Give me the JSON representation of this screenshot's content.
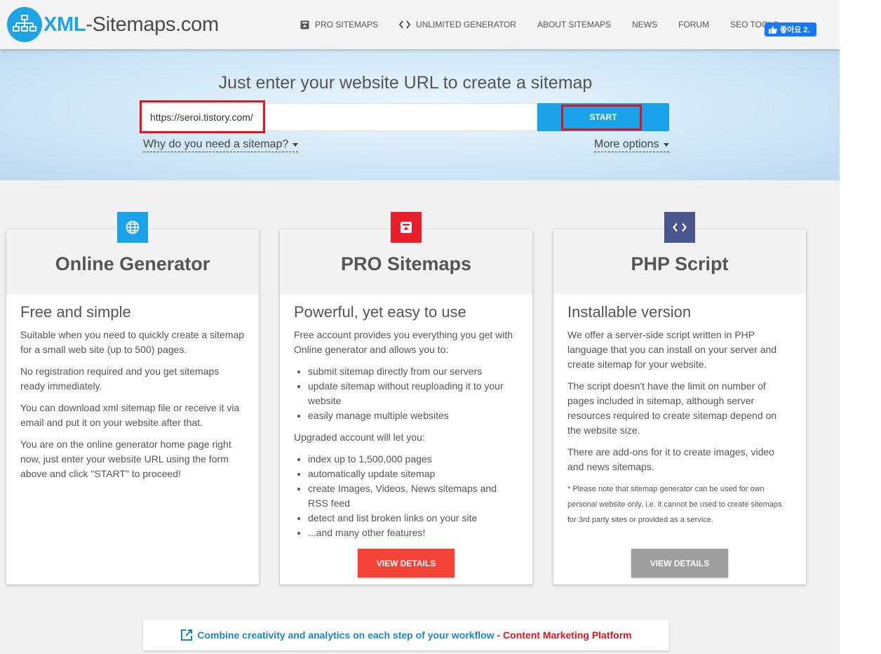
{
  "header": {
    "logo": {
      "accent": "XML",
      "rest": "-Sitemaps.com"
    },
    "nav": [
      {
        "label": "PRO SITEMAPS",
        "icon": "pro-sitemaps-icon"
      },
      {
        "label": "UNLIMITED GENERATOR",
        "icon": "code-brackets-icon"
      },
      {
        "label": "ABOUT SITEMAPS"
      },
      {
        "label": "NEWS"
      },
      {
        "label": "FORUM"
      },
      {
        "label": "SEO TOOLS"
      }
    ],
    "fb_like": "좋아요 2."
  },
  "hero": {
    "title": "Just enter your website URL to create a sitemap",
    "url_value": "https://seroi.tistory.com/",
    "start_label": "START",
    "why_link": "Why do you need a sitemap?",
    "more_link": "More options"
  },
  "cards": [
    {
      "title": "Online Generator",
      "subtitle": "Free and simple",
      "icon": "globe-icon",
      "color": "#1aa3e8",
      "paragraphs": [
        "Suitable when you need to quickly create a sitemap for a small web site (up to 500) pages.",
        "No registration required and you get sitemaps ready immediately.",
        "You can download xml sitemap file or receive it via email and put it on your website after that.",
        "You are on the online generator home page right now, just enter your website URL using the form above and click \"START\" to proceed!"
      ]
    },
    {
      "title": "PRO Sitemaps",
      "subtitle": "Powerful, yet easy to use",
      "icon": "pro-sitemaps-icon",
      "color": "#e8202c",
      "intro": "Free account provides you everything you get with Online generator and allows you to:",
      "list1": [
        "submit sitemap directly from our servers",
        "update sitemap without reuploading it to your website",
        "easily manage multiple websites"
      ],
      "mid": "Upgraded account will let you:",
      "list2": [
        "index up to 1,500,000 pages",
        "automatically update sitemap",
        "create Images, Videos, News sitemaps and RSS feed",
        "detect and list broken links on your site",
        "...and many other features!"
      ],
      "button": "VIEW DETAILS"
    },
    {
      "title": "PHP Script",
      "subtitle": "Installable version",
      "icon": "code-brackets-icon",
      "color": "#4a5690",
      "paragraphs": [
        "We offer a server-side script written in PHP language that you can install on your server and create sitemap for your website.",
        "The script doesn't have the limit on number of pages included in sitemap, although server resources required to create sitemap depend on the website size.",
        "There are add-ons for it to create images, video and news sitemaps."
      ],
      "note": "* Please note that sitemap generator can be used for own personal website only, i.e. it cannot be used to create sitemaps for 3rd party sites or provided as a service.",
      "button": "VIEW DETAILS"
    }
  ],
  "banner": {
    "blue": "Combine creativity and analytics on each step of your workflow",
    "sep": " - ",
    "red": "Content Marketing Platform",
    "icon": "external-link-icon"
  },
  "colors": {
    "accent": "#1aa3e8",
    "pro_red": "#e8202c",
    "php_blue": "#4a5690",
    "view_details_red": "#f44336",
    "view_details_grey": "#9e9e9e",
    "highlight": "#e0141f"
  }
}
